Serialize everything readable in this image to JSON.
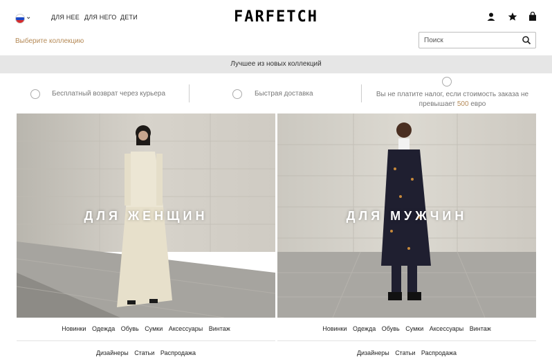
{
  "header": {
    "nav": [
      "ДЛЯ НЕЕ",
      "ДЛЯ НЕГО",
      "ДЕТИ"
    ],
    "logo": "FARFETCH",
    "icons": [
      "user-icon",
      "star-icon",
      "shopping-bag-icon"
    ]
  },
  "collection_label": "Выберите коллекцию",
  "search": {
    "placeholder": "Поиск"
  },
  "banner": "Лучшее из новых коллекций",
  "benefits": [
    {
      "icon": "return-icon",
      "text": "Бесплатный возврат через курьера"
    },
    {
      "icon": "delivery-icon",
      "text": "Быстрая доставка"
    },
    {
      "icon": "tax-icon",
      "text_line1": "Вы не платите налог, если стоимость заказа не",
      "text_line2_pre": "превышает ",
      "text_line2_amount": "500",
      "text_line2_post": " евро"
    }
  ],
  "panels": [
    {
      "title": "ДЛЯ ЖЕНЩИН",
      "links_row1": [
        "Новинки",
        "Одежда",
        "Обувь",
        "Сумки",
        "Аксессуары",
        "Винтаж"
      ],
      "links_row2": [
        "Дизайнеры",
        "Статьи",
        "Распродажа"
      ]
    },
    {
      "title": "ДЛЯ МУЖЧИН",
      "links_row1": [
        "Новинки",
        "Одежда",
        "Обувь",
        "Сумки",
        "Аксессуары",
        "Винтаж"
      ],
      "links_row2": [
        "Дизайнеры",
        "Статьи",
        "Распродажа"
      ]
    }
  ],
  "colors": {
    "accent_gold": "#b58a57",
    "banner_bg": "#e6e6e6"
  }
}
